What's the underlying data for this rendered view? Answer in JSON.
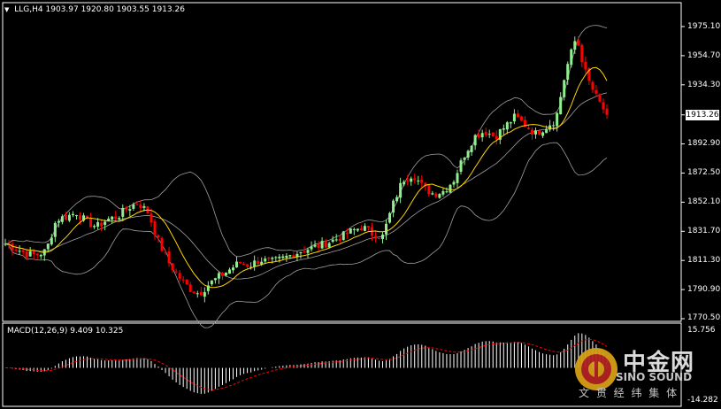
{
  "header": {
    "symbol_timeframe": "LLG,H4",
    "ohlc": "1903.97 1920.80 1903.55 1913.26"
  },
  "price_axis": {
    "labels": [
      "1975.10",
      "1954.70",
      "1934.30",
      "1913.26",
      "1892.90",
      "1872.50",
      "1852.10",
      "1831.70",
      "1811.30",
      "1790.90",
      "1770.50"
    ],
    "current_price": "1913.26"
  },
  "macd_panel": {
    "label": "MACD(12,26,9) 9.409 10.325",
    "axis_top": "15.756",
    "axis_bottom": "-14.282"
  },
  "watermark": {
    "name_cn": "中金网",
    "name_en": "SINO SOUND",
    "tagline": "文 贯 经 纬 集 体"
  },
  "colors": {
    "background": "#000000",
    "bull": "#90EE90",
    "bear": "#FF0000",
    "ma_line": "#FFD700",
    "bands": "#A0A0A0",
    "macd_hist": "#FFFFFF",
    "macd_signal": "#FF0000",
    "axis": "#FFFFFF"
  },
  "chart_data": {
    "type": "candlestick",
    "title": "LLG,H4",
    "ylim": [
      1770.5,
      1975.1
    ],
    "y_ticks": [
      1975.1,
      1954.7,
      1934.3,
      1913.26,
      1892.9,
      1872.5,
      1852.1,
      1831.7,
      1811.3,
      1790.9,
      1770.5
    ],
    "close_path": [
      1823,
      1820,
      1816,
      1815,
      1818,
      1840,
      1842,
      1845,
      1838,
      1835,
      1840,
      1842,
      1848,
      1852,
      1845,
      1825,
      1810,
      1800,
      1792,
      1788,
      1795,
      1800,
      1805,
      1810,
      1808,
      1812,
      1810,
      1812,
      1815,
      1818,
      1820,
      1822,
      1825,
      1828,
      1832,
      1835,
      1830,
      1828,
      1850,
      1868,
      1872,
      1862,
      1858,
      1860,
      1868,
      1885,
      1898,
      1902,
      1898,
      1905,
      1912,
      1906,
      1900,
      1905,
      1910,
      1945,
      1968,
      1940,
      1925,
      1913.26
    ],
    "macd": {
      "label": "MACD(12,26,9)",
      "main": 9.409,
      "signal": 10.325,
      "ylim": [
        -14.282,
        15.756
      ]
    },
    "indicators": [
      "Bollinger Bands",
      "Moving Average",
      "MACD"
    ]
  }
}
